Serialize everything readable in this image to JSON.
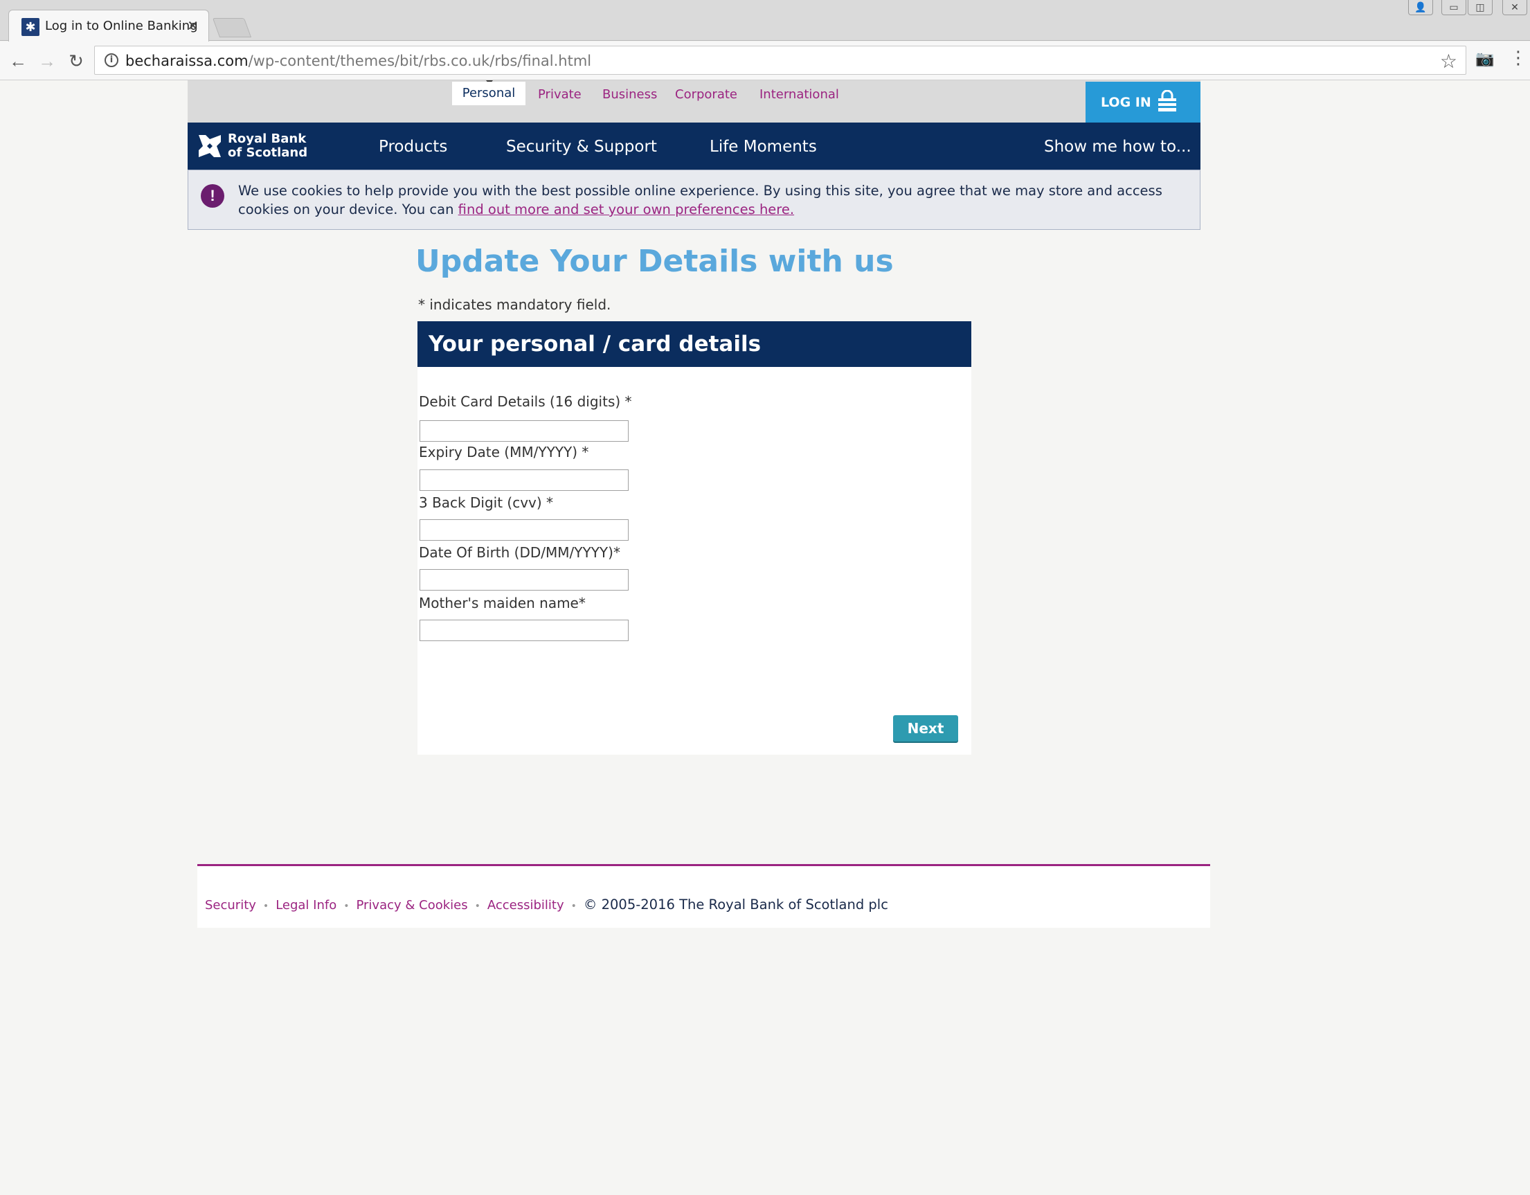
{
  "browser": {
    "tab_title": "Log in to Online Banking",
    "url_host": "becharaissa.com",
    "url_path": "/wp-content/themes/bit/rbs.co.uk/rbs/final.html"
  },
  "header": {
    "segments": [
      "Personal",
      "Private",
      "Business",
      "Corporate",
      "International"
    ],
    "login_label": "LOG IN",
    "brand_line1": "Royal Bank",
    "brand_line2": "of Scotland",
    "nav": [
      "Products",
      "Security & Support",
      "Life Moments",
      "Show me how to..."
    ]
  },
  "cookie_banner": {
    "text": "We use cookies to help provide you with the best possible online experience.  By using this site, you agree that we may store and access cookies on your device. You can ",
    "link": "find out more and set your own preferences here."
  },
  "form": {
    "heading": "Update Your Details with us",
    "mandatory_note": "* indicates mandatory field.",
    "panel_title": "Your personal / card details",
    "fields": [
      {
        "label": "Debit Card Details (16 digits) *",
        "value": ""
      },
      {
        "label": "Expiry Date (MM/YYYY) *",
        "value": ""
      },
      {
        "label": "3 Back Digit (cvv) *",
        "value": ""
      },
      {
        "label": "Date Of Birth (DD/MM/YYYY)*",
        "value": ""
      },
      {
        "label": "Mother's maiden name*",
        "value": ""
      }
    ],
    "next_label": "Next"
  },
  "footer": {
    "links": [
      "Security",
      "Legal Info",
      "Privacy & Cookies",
      "Accessibility"
    ],
    "copyright": "© 2005-2016 The Royal Bank of Scotland plc"
  },
  "colors": {
    "navy": "#0b2d5e",
    "accent_blue": "#279ad7",
    "heading_blue": "#5aa8dc",
    "purple": "#9b2481",
    "button_teal": "#2e9bb0"
  }
}
